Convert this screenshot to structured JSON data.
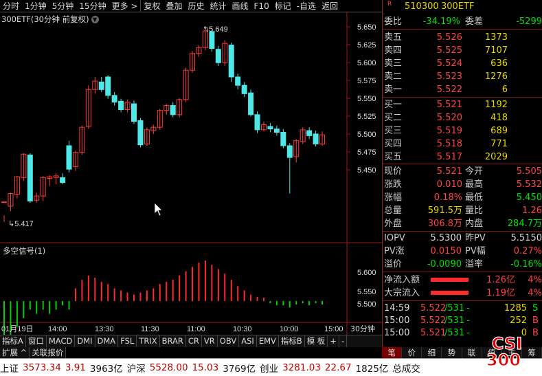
{
  "toolbar": {
    "items": [
      "分时",
      "1分钟",
      "5分钟",
      "15分钟",
      "更多 >",
      "复权",
      "叠加",
      "历史",
      "统计",
      "画线",
      "F10",
      "标记",
      "-自选",
      "返回"
    ]
  },
  "chart": {
    "title": "300ETF(30分钟 前复权)",
    "indicator_title": "多空信号(1)",
    "high_label": "5.649",
    "low_label": "5.417",
    "price_ticks": [
      "5.650",
      "5.625",
      "5.600",
      "5.575",
      "5.550",
      "5.525",
      "5.500",
      "5.475",
      "5.450"
    ],
    "indicator_ticks": [
      "5.600",
      "5.550",
      "5.500"
    ],
    "time_labels": [
      "01月19日",
      "14:00",
      "13:30",
      "11:30",
      "11:00",
      "10:30",
      "10:00",
      "15:00"
    ],
    "period_btn": "30分钟"
  },
  "chart_data": {
    "type": "candlestick",
    "title": "300ETF(30分钟 前复权)",
    "candles": [
      [
        5.441,
        5.441,
        5.425,
        5.417
      ],
      [
        5.436,
        5.451,
        5.452,
        5.43
      ],
      [
        5.45,
        5.471,
        5.472,
        5.445
      ],
      [
        5.47,
        5.498,
        5.499,
        5.466
      ],
      [
        5.497,
        5.442,
        5.499,
        5.44
      ],
      [
        5.443,
        5.448,
        5.452,
        5.44
      ],
      [
        5.448,
        5.47,
        5.472,
        5.442
      ],
      [
        5.469,
        5.471,
        5.473,
        5.46
      ],
      [
        5.47,
        5.472,
        5.475,
        5.462
      ],
      [
        5.47,
        5.464,
        5.475,
        5.462
      ],
      [
        5.508,
        5.48,
        5.514,
        5.476
      ],
      [
        5.483,
        5.5,
        5.502,
        5.478
      ],
      [
        5.5,
        5.53,
        5.532,
        5.497
      ],
      [
        5.531,
        5.575,
        5.58,
        5.528
      ],
      [
        5.575,
        5.585,
        5.59,
        5.57
      ],
      [
        5.584,
        5.575,
        5.59,
        5.572
      ],
      [
        5.59,
        5.568,
        5.592,
        5.564
      ],
      [
        5.568,
        5.56,
        5.572,
        5.556
      ],
      [
        5.561,
        5.551,
        5.564,
        5.548
      ],
      [
        5.551,
        5.56,
        5.563,
        5.548
      ],
      [
        5.558,
        5.537,
        5.562,
        5.534
      ],
      [
        5.538,
        5.509,
        5.541,
        5.506
      ],
      [
        5.51,
        5.527,
        5.53,
        5.508
      ],
      [
        5.526,
        5.53,
        5.533,
        5.522
      ],
      [
        5.53,
        5.55,
        5.552,
        5.527
      ],
      [
        5.55,
        5.556,
        5.558,
        5.545
      ],
      [
        5.556,
        5.545,
        5.56,
        5.542
      ],
      [
        5.545,
        5.563,
        5.565,
        5.542
      ],
      [
        5.563,
        5.598,
        5.601,
        5.56
      ],
      [
        5.598,
        5.618,
        5.621,
        5.595
      ],
      [
        5.618,
        5.625,
        5.628,
        5.614
      ],
      [
        5.625,
        5.645,
        5.649,
        5.622
      ],
      [
        5.644,
        5.624,
        5.646,
        5.62
      ],
      [
        5.623,
        5.607,
        5.627,
        5.603
      ],
      [
        5.607,
        5.63,
        5.634,
        5.603
      ],
      [
        5.628,
        5.59,
        5.631,
        5.584
      ],
      [
        5.59,
        5.58,
        5.594,
        5.575
      ],
      [
        5.58,
        5.57,
        5.584,
        5.566
      ],
      [
        5.571,
        5.545,
        5.575,
        5.543
      ],
      [
        5.545,
        5.527,
        5.549,
        5.523
      ],
      [
        5.527,
        5.533,
        5.537,
        5.525
      ],
      [
        5.531,
        5.528,
        5.535,
        5.524
      ],
      [
        5.528,
        5.524,
        5.532,
        5.52
      ],
      [
        5.524,
        5.508,
        5.528,
        5.505
      ],
      [
        5.508,
        5.494,
        5.511,
        5.451
      ],
      [
        5.495,
        5.514,
        5.516,
        5.488
      ],
      [
        5.513,
        5.527,
        5.53,
        5.51
      ],
      [
        5.526,
        5.52,
        5.53,
        5.516
      ],
      [
        5.522,
        5.51,
        5.526,
        5.507
      ],
      [
        5.51,
        5.521,
        5.525,
        5.508
      ]
    ],
    "signal": [
      -0.8,
      -0.8,
      -0.6,
      -0.4,
      -0.2,
      -0.3,
      -0.2,
      -0.3,
      -0.2,
      -0.1,
      -0.2,
      0.3,
      0.5,
      0.6,
      0.55,
      0.45,
      0.4,
      0.3,
      0.25,
      0.2,
      0.15,
      0.2,
      0.25,
      0.3,
      0.4,
      0.45,
      0.5,
      0.6,
      0.7,
      0.8,
      0.9,
      0.95,
      0.85,
      0.75,
      0.65,
      0.5,
      0.35,
      0.25,
      0.15,
      0.1,
      0.08,
      -0.05,
      -0.1,
      -0.1,
      -0.15,
      -0.08,
      -0.05,
      -0.1,
      -0.05,
      -0.08
    ],
    "ylim": [
      5.417,
      5.649
    ]
  },
  "quote": {
    "code": "510300",
    "name": "300ETF",
    "weibi_label": "委比",
    "weibi": "-34.19%",
    "weicha_label": "委差",
    "weicha": "-5299",
    "asks": [
      {
        "label": "卖五",
        "price": "5.526",
        "vol": "1373"
      },
      {
        "label": "卖四",
        "price": "5.525",
        "vol": "7107"
      },
      {
        "label": "卖三",
        "price": "5.524",
        "vol": "636"
      },
      {
        "label": "卖二",
        "price": "5.523",
        "vol": "1276"
      },
      {
        "label": "卖一",
        "price": "5.522",
        "vol": "6"
      }
    ],
    "bids": [
      {
        "label": "买一",
        "price": "5.521",
        "vol": "1192"
      },
      {
        "label": "买二",
        "price": "5.520",
        "vol": "418"
      },
      {
        "label": "买三",
        "price": "5.519",
        "vol": "689"
      },
      {
        "label": "买四",
        "price": "5.518",
        "vol": "771"
      },
      {
        "label": "买五",
        "price": "5.517",
        "vol": "2029"
      }
    ],
    "stats": [
      [
        "现价",
        "5.521",
        "今开",
        "5.505"
      ],
      [
        "涨跌",
        "0.010",
        "最高",
        "5.532"
      ],
      [
        "涨幅",
        "0.18%",
        "最低",
        "5.450"
      ],
      [
        "总量",
        "591.5万",
        "量比",
        "1.26"
      ],
      [
        "外盘",
        "306.8万",
        "内盘",
        "284.7万"
      ]
    ],
    "iopv": [
      [
        "IOPV",
        "5.5300",
        "昨PV",
        "5.5150"
      ],
      [
        "PV涨",
        "0.0150",
        "PV幅",
        "0.27%"
      ],
      [
        "溢价",
        "-0.0090",
        "溢率",
        "-0.16%"
      ]
    ],
    "flows": [
      [
        "净流入额",
        "1.26亿",
        "4%"
      ],
      [
        "大宗流入",
        "1.19亿",
        "4%"
      ]
    ],
    "ticks": [
      [
        "14:59",
        "5.522",
        "/531",
        "-",
        "1285",
        "S"
      ],
      [
        "15:00",
        "5.522",
        "/531",
        "-",
        "252",
        "B"
      ],
      [
        "15:00",
        "5.521",
        "/531",
        "-",
        "0",
        "B"
      ]
    ]
  },
  "tabs": [
    "指标A",
    "窗口",
    "MACD",
    "DMI",
    "DMA",
    "FSL",
    "TRIX",
    "BRAR",
    "CR",
    "VR",
    "OBV",
    "ASI",
    "EMV",
    "指标B",
    "模 板",
    "+",
    "-"
  ],
  "tabs2": [
    "扩展 ^",
    "关联报价"
  ],
  "rtabs": [
    "笔",
    "价",
    "细",
    "势",
    "联",
    "值",
    "主",
    "筹"
  ],
  "bottom": {
    "sh": "上证",
    "sh_v": "3573.34",
    "sh_c": "3.91",
    "sh_a": "3963亿",
    "sz": "沪深",
    "sz_v": "5528.00",
    "sz_c": "15.03",
    "sz_a": "3769亿",
    "cy": "创业",
    "cy_v": "3281.03",
    "cy_c": "22.67",
    "cy_a": "1825亿",
    "total": "总成交"
  },
  "logo": {
    "text1": "CSI",
    "text2": "300"
  }
}
